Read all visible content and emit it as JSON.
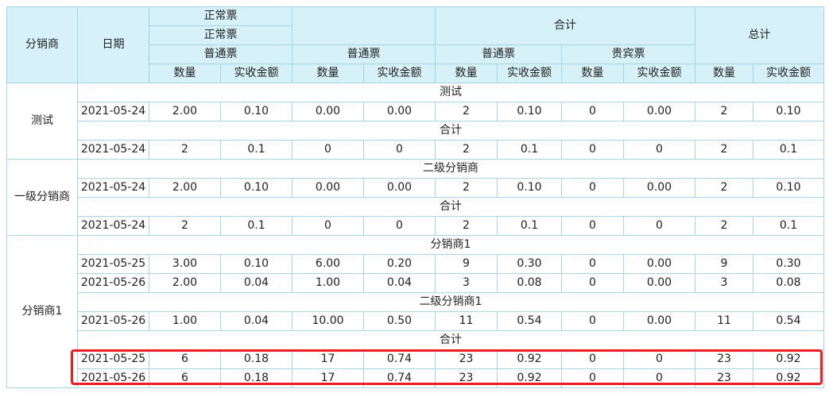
{
  "header": {
    "distributor": "分销商",
    "date": "日期",
    "normal_ticket": "正常票",
    "normal_ticket_sub": "正常票",
    "total_group": "合计",
    "grand_total": "总计",
    "regular": "普通票",
    "vip": "贵宾票",
    "qty": "数量",
    "amount": "实收金额"
  },
  "groups": [
    {
      "distributor": "测试",
      "sections": [
        {
          "title": "测试",
          "rows": [
            [
              "2021-05-24",
              "2.00",
              "0.10",
              "0.00",
              "0.00",
              "2",
              "0.10",
              "0",
              "0.00",
              "2",
              "0.10"
            ]
          ]
        },
        {
          "title": "合计",
          "rows": [
            [
              "2021-05-24",
              "2",
              "0.1",
              "0",
              "0",
              "2",
              "0.1",
              "0",
              "0",
              "2",
              "0.1"
            ]
          ]
        }
      ]
    },
    {
      "distributor": "一级分销商",
      "sections": [
        {
          "title": "二级分销商",
          "rows": [
            [
              "2021-05-24",
              "2.00",
              "0.10",
              "0.00",
              "0.00",
              "2",
              "0.10",
              "0",
              "0.00",
              "2",
              "0.10"
            ]
          ]
        },
        {
          "title": "合计",
          "rows": [
            [
              "2021-05-24",
              "2",
              "0.1",
              "0",
              "0",
              "2",
              "0.1",
              "0",
              "0",
              "2",
              "0.1"
            ]
          ]
        }
      ]
    },
    {
      "distributor": "分销商1",
      "sections": [
        {
          "title": "分销商1",
          "rows": [
            [
              "2021-05-25",
              "3.00",
              "0.10",
              "6.00",
              "0.20",
              "9",
              "0.30",
              "0",
              "0.00",
              "9",
              "0.30"
            ],
            [
              "2021-05-26",
              "2.00",
              "0.04",
              "1.00",
              "0.04",
              "3",
              "0.08",
              "0",
              "0.00",
              "3",
              "0.08"
            ]
          ]
        },
        {
          "title": "二级分销商1",
          "rows": [
            [
              "2021-05-26",
              "1.00",
              "0.04",
              "10.00",
              "0.50",
              "11",
              "0.54",
              "0",
              "0.00",
              "11",
              "0.54"
            ]
          ]
        },
        {
          "title": "合计",
          "rows": [
            [
              "2021-05-25",
              "6",
              "0.18",
              "17",
              "0.74",
              "23",
              "0.92",
              "0",
              "0",
              "23",
              "0.92"
            ],
            [
              "2021-05-26",
              "6",
              "0.18",
              "17",
              "0.74",
              "23",
              "0.92",
              "0",
              "0",
              "23",
              "0.92"
            ]
          ]
        }
      ]
    }
  ],
  "colors": {
    "header_bg": "#d7f1f8",
    "border": "#a9d4e4",
    "highlight": "#ee1c24"
  }
}
